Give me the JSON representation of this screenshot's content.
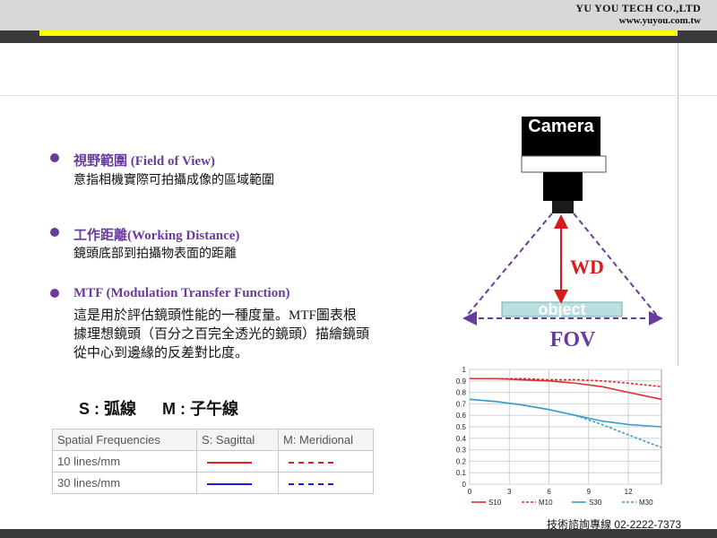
{
  "header": {
    "company_name": "YU YOU TECH CO.,LTD",
    "website": "www.yuyou.com.tw"
  },
  "bullets": [
    {
      "title": "視野範圍 (Field of View)",
      "desc": "意指相機實際可拍攝成像的區域範圍"
    },
    {
      "title": "工作距離(Working Distance)",
      "desc": "鏡頭底部到拍攝物表面的距離"
    },
    {
      "title": "MTF (Modulation Transfer Function)",
      "desc": "這是用於評估鏡頭性能的一種度量。MTF圖表根據理想鏡頭（百分之百完全透光的鏡頭）描繪鏡頭從中心到邊緣的反差對比度。"
    }
  ],
  "legend_text": {
    "s": "S : 弧線",
    "m": "M : 子午線"
  },
  "freq_table": {
    "headers": [
      "Spatial Frequencies",
      "S: Sagittal",
      "M: Meridional"
    ],
    "rows": [
      {
        "label": "10 lines/mm",
        "color": "#e02020"
      },
      {
        "label": "30 lines/mm",
        "color": "#1a1adc"
      }
    ]
  },
  "diagram": {
    "camera_label": "Camera",
    "wd_label": "WD",
    "object_label": "object",
    "fov_label": "FOV",
    "colors": {
      "wd": "#d81a1a",
      "fov": "#6a3b9e",
      "object": "#b9dfe0"
    }
  },
  "chart_data": {
    "type": "line",
    "xticks": [
      "0",
      "3",
      "6",
      "9",
      "12"
    ],
    "yticks": [
      "0",
      "0.1",
      "0.2",
      "0.3",
      "0.4",
      "0.5",
      "0.6",
      "0.7",
      "0.8",
      "0.9",
      "1"
    ],
    "xlim": [
      0,
      14.5
    ],
    "ylim": [
      0,
      1
    ],
    "grid": true,
    "series": [
      {
        "name": "S10",
        "color": "#e02c2c",
        "dashed": false,
        "x": [
          0,
          2,
          4,
          6,
          8,
          10,
          12,
          14.5
        ],
        "y": [
          0.92,
          0.92,
          0.91,
          0.9,
          0.88,
          0.85,
          0.8,
          0.74
        ]
      },
      {
        "name": "M10",
        "color": "#e02c2c",
        "dashed": true,
        "x": [
          0,
          2,
          4,
          6,
          8,
          10,
          12,
          14.5
        ],
        "y": [
          0.92,
          0.92,
          0.92,
          0.91,
          0.91,
          0.9,
          0.88,
          0.85
        ]
      },
      {
        "name": "S30",
        "color": "#3a9ec8",
        "dashed": false,
        "x": [
          0,
          2,
          4,
          6,
          8,
          10,
          12,
          14.5
        ],
        "y": [
          0.74,
          0.72,
          0.69,
          0.65,
          0.6,
          0.55,
          0.52,
          0.5
        ]
      },
      {
        "name": "M30",
        "color": "#3a9ec8",
        "dashed": true,
        "x": [
          0,
          2,
          4,
          6,
          8,
          10,
          12,
          14.5
        ],
        "y": [
          0.74,
          0.72,
          0.69,
          0.65,
          0.6,
          0.52,
          0.43,
          0.32
        ]
      }
    ]
  },
  "footer": {
    "hotline": "技術諮詢專線 02-2222-7373"
  }
}
